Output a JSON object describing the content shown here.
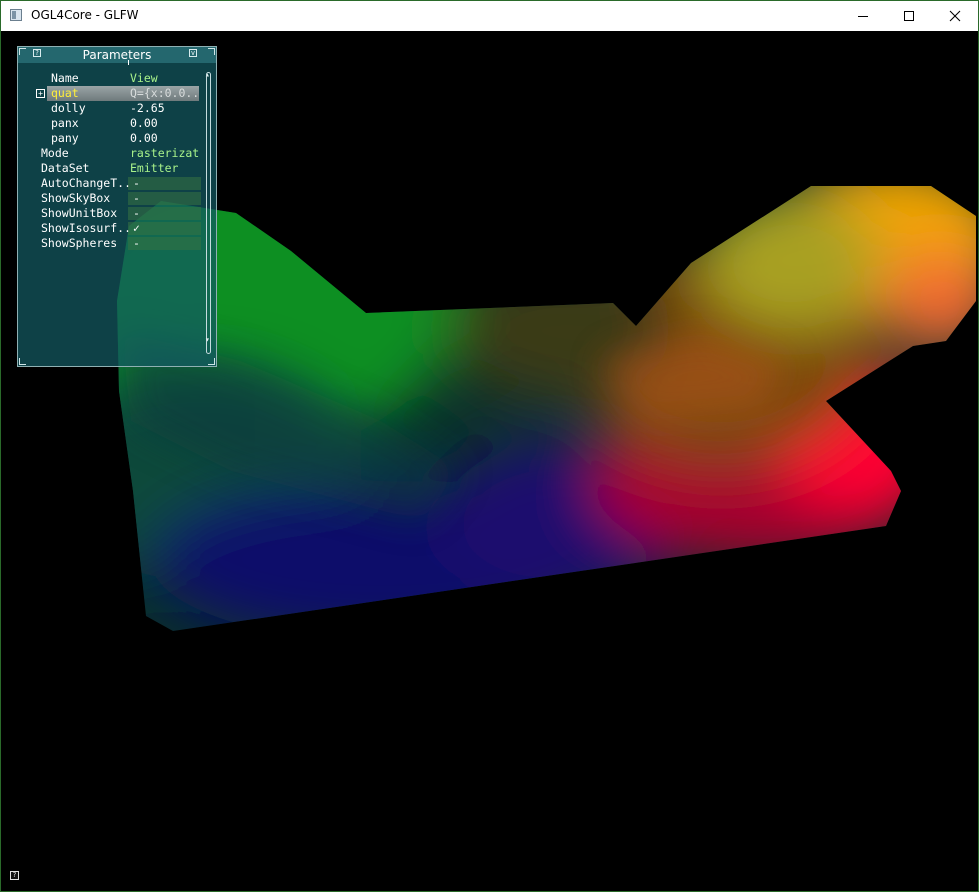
{
  "window": {
    "title": "OGL4Core - GLFW",
    "controls": {
      "minimize_icon": "minimize-icon",
      "maximize_icon": "maximize-icon",
      "close_icon": "close-icon"
    }
  },
  "tweakbar": {
    "title": "Parameters",
    "help_icon": "?",
    "minimize_icon": "v",
    "header": {
      "label": "Name",
      "value": "View"
    },
    "view_params": [
      {
        "label": "quat",
        "value": "Q={x:0.0..",
        "selected": true,
        "expandable": true,
        "expander": "+"
      },
      {
        "label": "dolly",
        "value": "-2.65"
      },
      {
        "label": "panx",
        "value": "0.00"
      },
      {
        "label": "pany",
        "value": "0.00"
      }
    ],
    "params": [
      {
        "label": "Mode",
        "value": "rasterizat..",
        "type": "enum"
      },
      {
        "label": "DataSet",
        "value": "Emitter",
        "type": "enum"
      },
      {
        "label": "AutoChangeT..",
        "value": "-",
        "type": "bool"
      },
      {
        "label": "ShowSkyBox",
        "value": "-",
        "type": "bool"
      },
      {
        "label": "ShowUnitBox",
        "value": "-",
        "type": "bool"
      },
      {
        "label": "ShowIsosurf..",
        "value": "✓",
        "type": "bool"
      },
      {
        "label": "ShowSpheres",
        "value": "-",
        "type": "bool"
      }
    ]
  },
  "colors": {
    "background": "#000000",
    "panel": "#145a62",
    "value_green": "#a8f28a",
    "selected_label": "#ffef3a"
  },
  "footer": {
    "help_icon": "?"
  }
}
